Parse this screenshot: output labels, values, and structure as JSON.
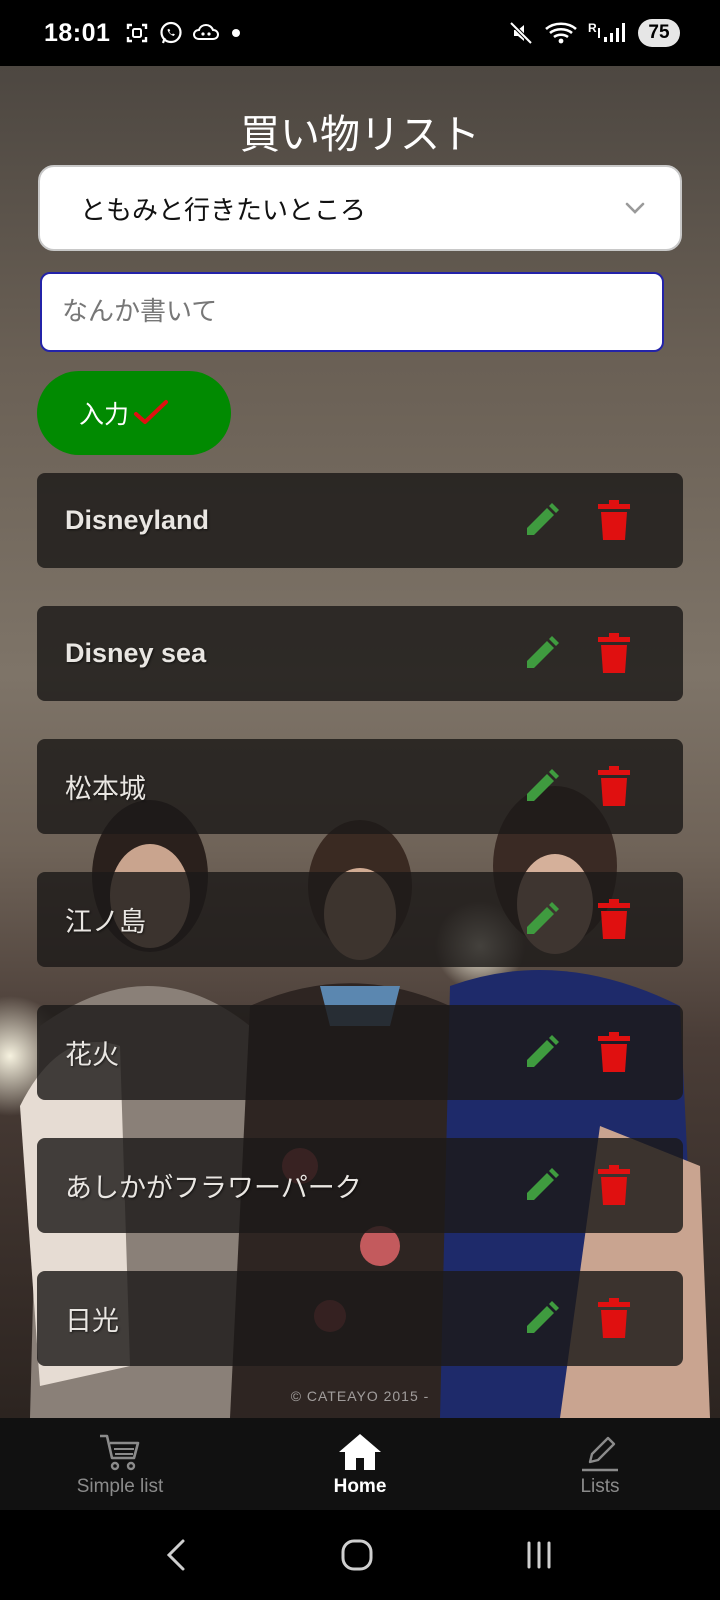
{
  "status_bar": {
    "time": "18:01",
    "battery": "75",
    "icons_left": [
      "screenshot-icon",
      "whatsapp-icon",
      "cloud-icon",
      "notification-dot"
    ],
    "icons_right": [
      "mute-icon",
      "wifi-icon",
      "signal-icon"
    ]
  },
  "app": {
    "title": "買い物リスト",
    "select": {
      "value": "ともみと行きたいところ"
    },
    "input": {
      "placeholder": "なんか書いて",
      "value": ""
    },
    "enter_button": {
      "label": "入力"
    },
    "items": [
      {
        "label": "Disneyland"
      },
      {
        "label": "Disney sea"
      },
      {
        "label": "松本城"
      },
      {
        "label": "江ノ島"
      },
      {
        "label": "花火"
      },
      {
        "label": "あしかがフラワーパーク"
      },
      {
        "label": "日光"
      }
    ],
    "copyright": "© CATEAYO 2015 -"
  },
  "bottom_nav": {
    "items": [
      {
        "label": "Simple list",
        "icon": "cart-icon",
        "active": false
      },
      {
        "label": "Home",
        "icon": "home-icon",
        "active": true
      },
      {
        "label": "Lists",
        "icon": "pencil-icon",
        "active": false
      }
    ]
  },
  "colors": {
    "accent_green": "#018a01",
    "edit_green": "#3f9b3f",
    "delete_red": "#e01010",
    "input_border": "#2323a8"
  }
}
